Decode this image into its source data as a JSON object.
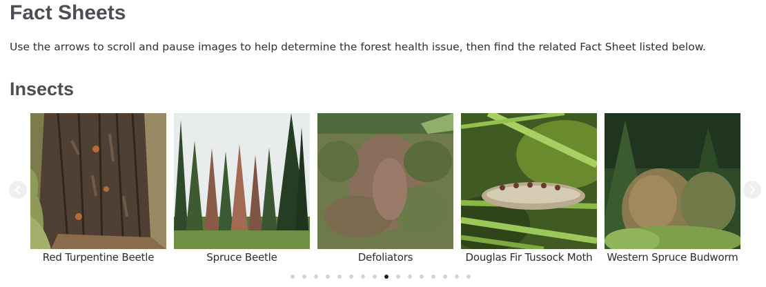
{
  "page": {
    "title": "Fact Sheets",
    "intro": "Use the arrows to scroll and pause images to help determine the forest health issue, then find the related Fact Sheet listed below."
  },
  "section": {
    "title": "Insects"
  },
  "carousel": {
    "slides": [
      {
        "caption": "Red Turpentine Beetle",
        "image": "tree-bark-photo"
      },
      {
        "caption": "Spruce Beetle",
        "image": "spruce-forest-photo"
      },
      {
        "caption": "Defoliators",
        "image": "aerial-forest-photo"
      },
      {
        "caption": "Douglas Fir Tussock Moth",
        "image": "caterpillar-photo"
      },
      {
        "caption": "Western Spruce Budworm",
        "image": "spruce-branches-photo"
      }
    ],
    "prev_icon": "chevron-left-circle-icon",
    "next_icon": "chevron-right-circle-icon",
    "dot_count": 16,
    "active_dot": 8
  },
  "colors": {
    "heading": "#4b4e54",
    "text": "#2e3034",
    "dot_inactive": "#d3d3d3",
    "dot_active": "#1a1a1a",
    "arrow_bg": "#efefef"
  }
}
